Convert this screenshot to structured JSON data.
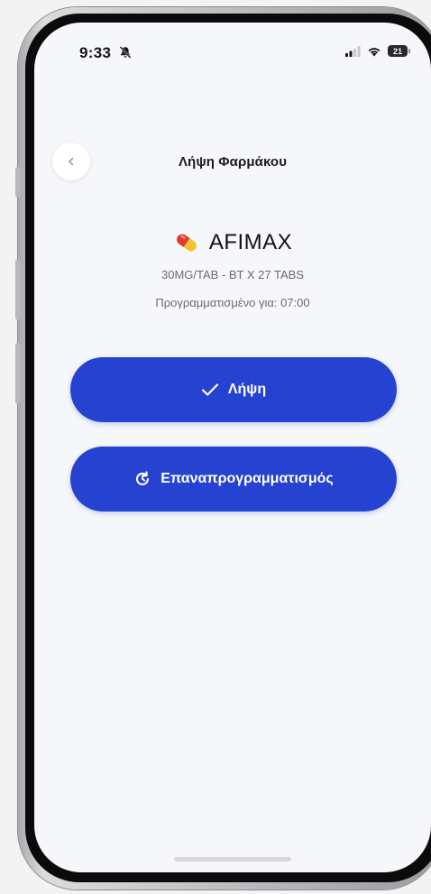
{
  "status_bar": {
    "time": "9:33",
    "battery": "21",
    "icons": [
      "bell-slash-icon",
      "signal-icon",
      "wifi-icon",
      "battery-icon"
    ]
  },
  "header": {
    "title": "Λήψη Φαρμάκου",
    "back_icon": "chevron-left-icon"
  },
  "medication": {
    "icon": "pill-icon",
    "name": "AFIMAX",
    "dosage": "30MG/TAB - BT X 27 TABS",
    "schedule": "Προγραμματισμένο για: 07:00"
  },
  "actions": {
    "take_label": "Λήψη",
    "take_icon": "check-icon",
    "reschedule_label": "Επαναπρογραμματισμός",
    "reschedule_icon": "reschedule-clock-icon"
  },
  "colors": {
    "accent": "#2642d0",
    "background": "#f6f7fb",
    "text_primary": "#121212",
    "text_secondary": "#6a6a70"
  }
}
